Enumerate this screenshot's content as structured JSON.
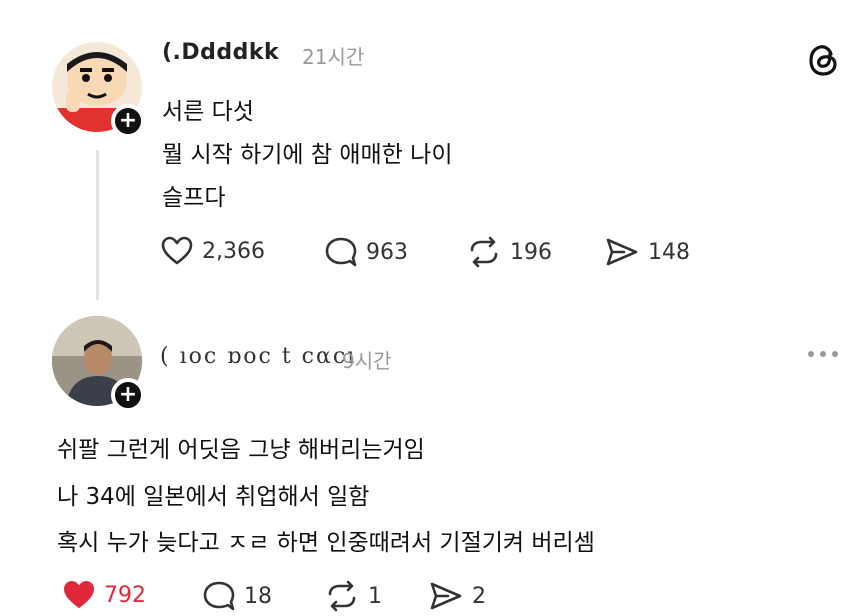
{
  "post1": {
    "username": "(.Ddddkk",
    "time": "21시간",
    "lines": [
      "서른 다섯",
      "뭘 시작 하기에 참 애매한 나이",
      "슬프다"
    ],
    "likes": "2,366",
    "comments": "963",
    "reposts": "196",
    "shares": "148"
  },
  "post2": {
    "username": "( ıoc ɒoc t cαcı",
    "time": "9시간",
    "lines": [
      "쉬팔 그런게 어딧음 그냥 해버리는거임",
      "나 34에 일본에서 취업해서 일함",
      "혹시 누가 늦다고 ㅈㄹ 하면 인중때려서 기절기켜 버리셈"
    ],
    "likes": "792",
    "comments": "18",
    "reposts": "1",
    "shares": "2"
  },
  "icons": {
    "app": "threads-logo-icon",
    "more": "more-options-icon",
    "like": "heart-icon",
    "comment": "comment-bubble-icon",
    "repost": "repost-icon",
    "share": "send-icon",
    "follow": "plus-icon"
  },
  "colors": {
    "liked": "#e0283d",
    "muted": "#999999",
    "text": "#111111"
  }
}
